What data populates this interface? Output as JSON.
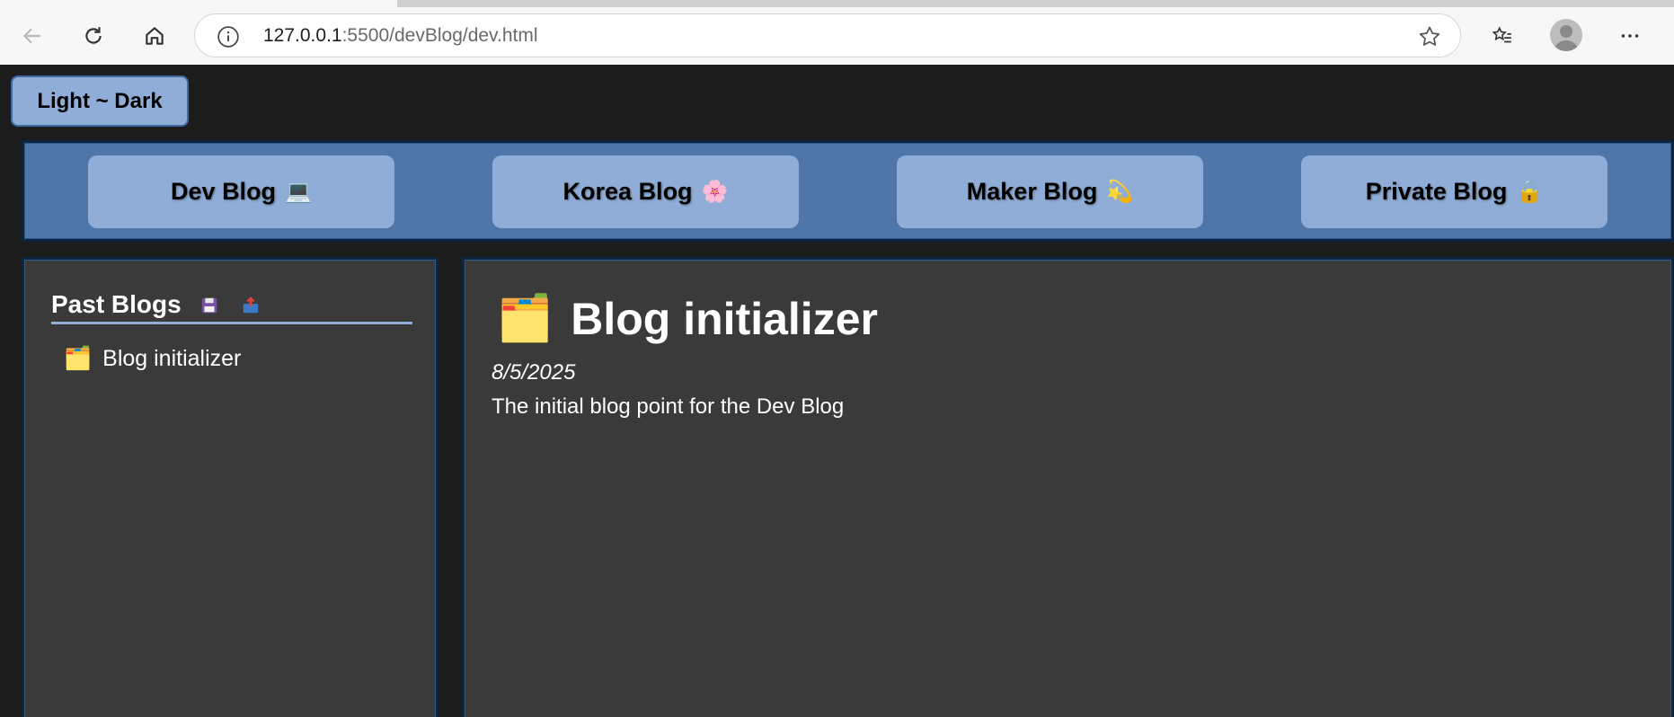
{
  "browser": {
    "url_host": "127.0.0.1",
    "url_rest": ":5500/devBlog/dev.html"
  },
  "theme_toggle": {
    "label": "Light ~ Dark"
  },
  "nav": [
    {
      "label": "Dev Blog",
      "emoji": "💻"
    },
    {
      "label": "Korea Blog",
      "emoji": "🌸"
    },
    {
      "label": "Maker Blog",
      "emoji": "💫"
    },
    {
      "label": "Private Blog",
      "emoji": "🔒"
    }
  ],
  "sidebar": {
    "title": "Past Blogs",
    "icons": [
      "save-icon",
      "upload-icon"
    ],
    "items": [
      {
        "label": "Blog initializer",
        "icon": "🗂️"
      }
    ]
  },
  "post": {
    "icon": "🗂️",
    "title": "Blog initializer",
    "date": "8/5/2025",
    "description": "The initial blog point for the Dev Blog"
  },
  "colors": {
    "accent": "#8fadd6",
    "nav_bg": "#4e76a8",
    "panel_bg": "#3a3a3a",
    "page_bg": "#1c1c1c"
  }
}
